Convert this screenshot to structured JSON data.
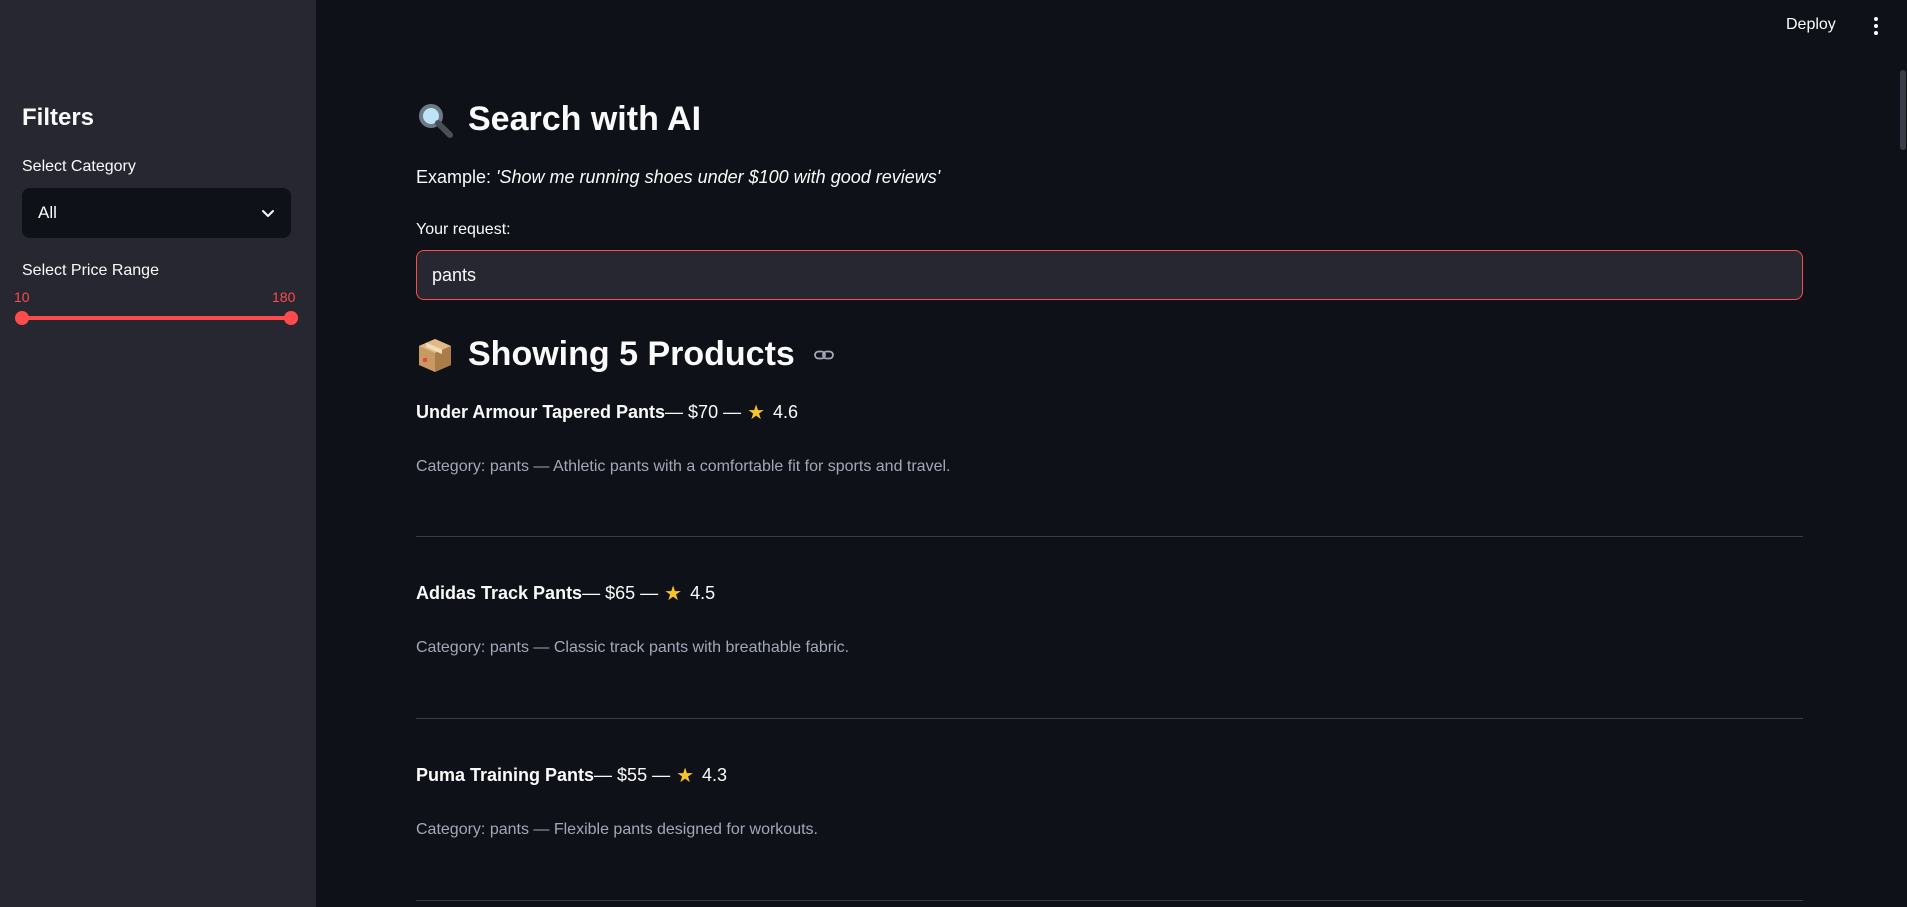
{
  "topbar": {
    "deploy_label": "Deploy"
  },
  "sidebar": {
    "title": "Filters",
    "category_label": "Select Category",
    "category_value": "All",
    "price_label": "Select Price Range",
    "price_min": "10",
    "price_max": "180"
  },
  "main": {
    "title": "Search with AI",
    "example_prefix": "Example: ",
    "example_text": "'Show me running shoes under $100 with good reviews'",
    "request_label": "Your request:",
    "request_value": "pants",
    "results_title": "Showing 5 Products",
    "products": [
      {
        "name": "Under Armour Tapered Pants",
        "price_text": " — $70 — ",
        "star": "★",
        "rating": "4.6",
        "description": "Category: pants — Athletic pants with a comfortable fit for sports and travel."
      },
      {
        "name": "Adidas Track Pants",
        "price_text": " — $65 — ",
        "star": "★",
        "rating": "4.5",
        "description": "Category: pants — Classic track pants with breathable fabric."
      },
      {
        "name": "Puma Training Pants",
        "price_text": " — $55 — ",
        "star": "★",
        "rating": "4.3",
        "description": "Category: pants — Flexible pants designed for workouts."
      }
    ]
  },
  "icons": {
    "search": "magnifying-glass-icon",
    "package": "package-icon",
    "link": "link-icon",
    "menu": "kebab-menu-icon",
    "dropdown": "chevron-down-icon"
  },
  "colors": {
    "accent": "#ff4b4b",
    "background": "#0e1117",
    "sidebar": "#262730",
    "star": "#f7c52b"
  }
}
